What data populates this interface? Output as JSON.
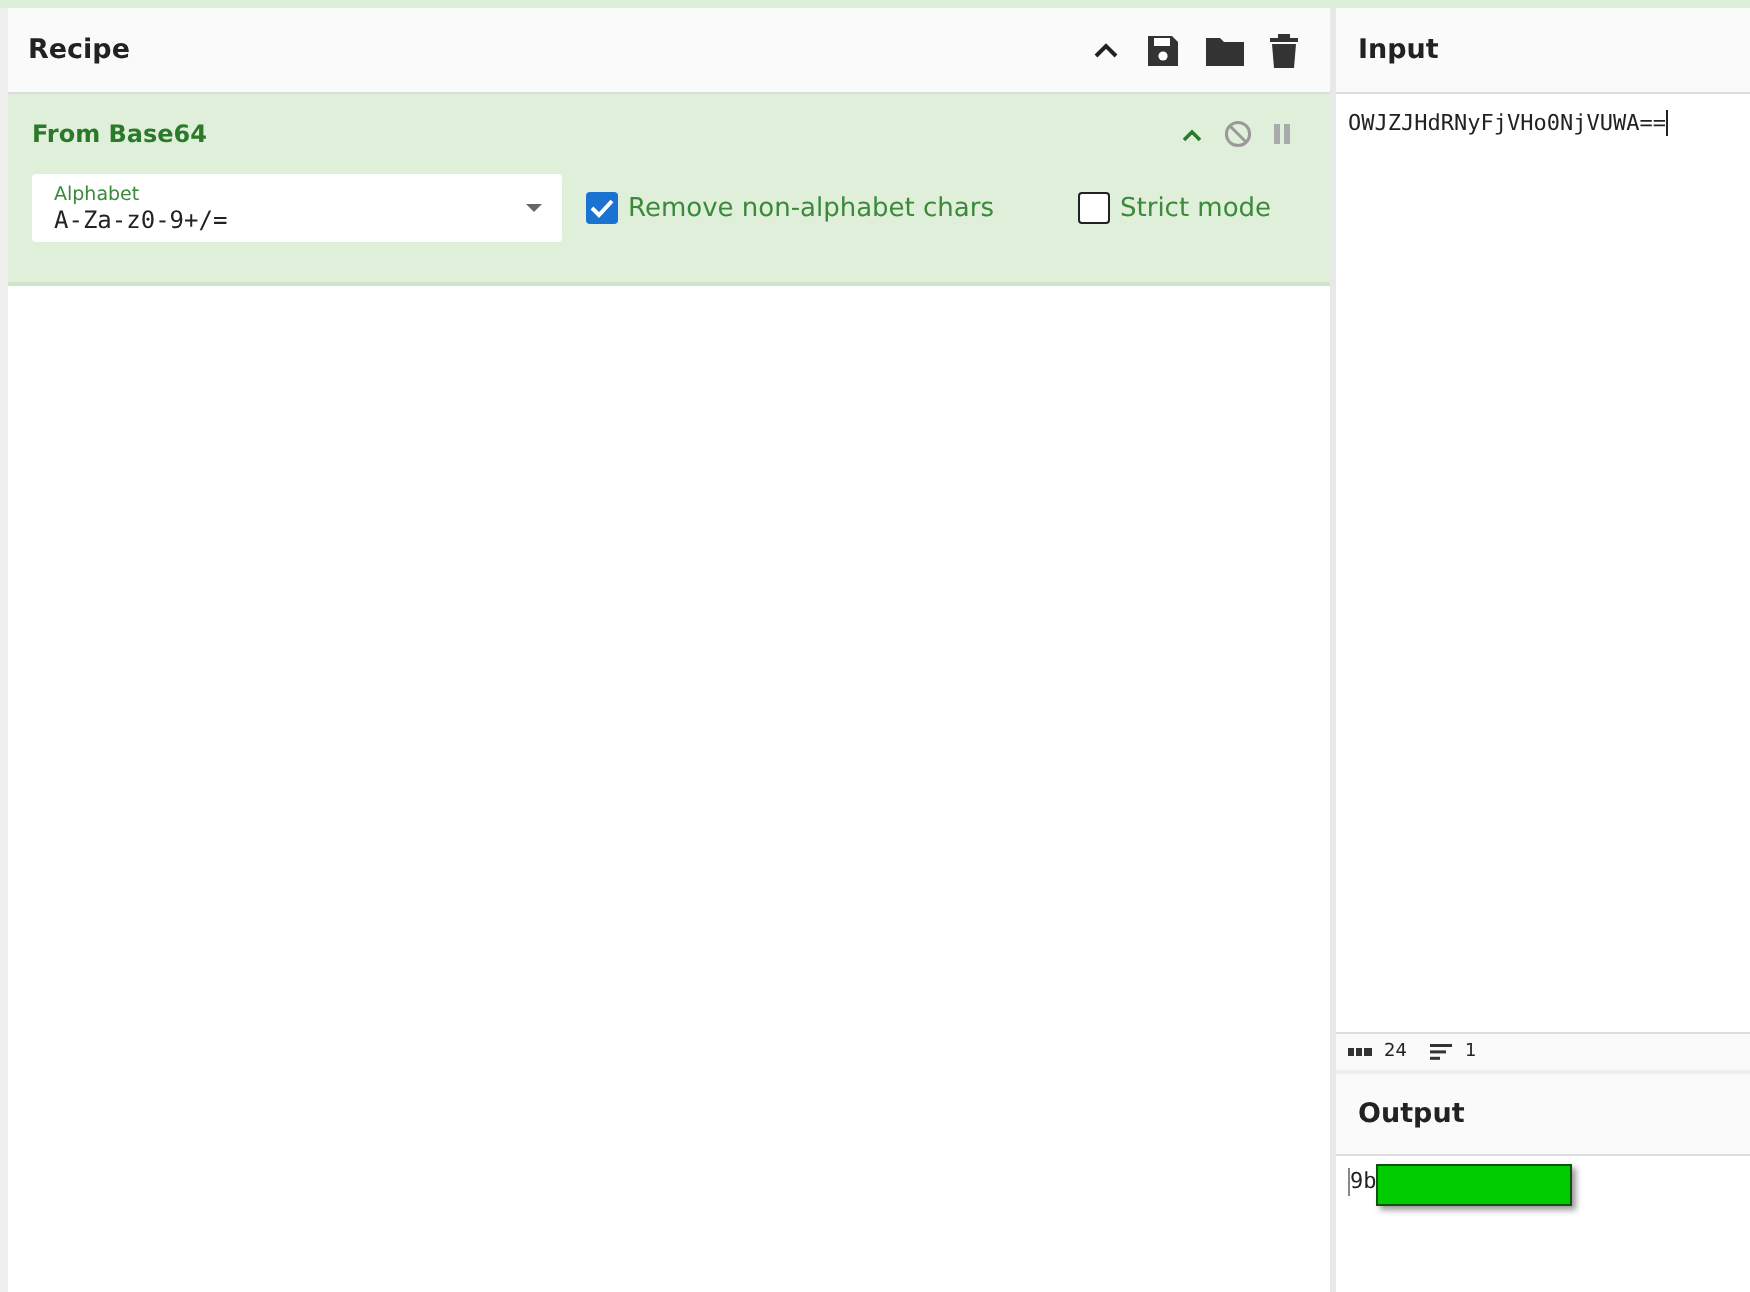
{
  "recipe": {
    "title": "Recipe",
    "operations": [
      {
        "name": "From Base64",
        "alphabet": {
          "label": "Alphabet",
          "value": "A-Za-z0-9+/="
        },
        "options": [
          {
            "label": "Remove non-alphabet chars",
            "checked": true
          },
          {
            "label": "Strict mode",
            "checked": false
          }
        ]
      }
    ]
  },
  "input": {
    "title": "Input",
    "text": "OWJZJHdRNyFjVHo0NjVUWA==",
    "length": "24",
    "lines": "1"
  },
  "output": {
    "title": "Output",
    "text": "9b",
    "redacted": true
  }
}
